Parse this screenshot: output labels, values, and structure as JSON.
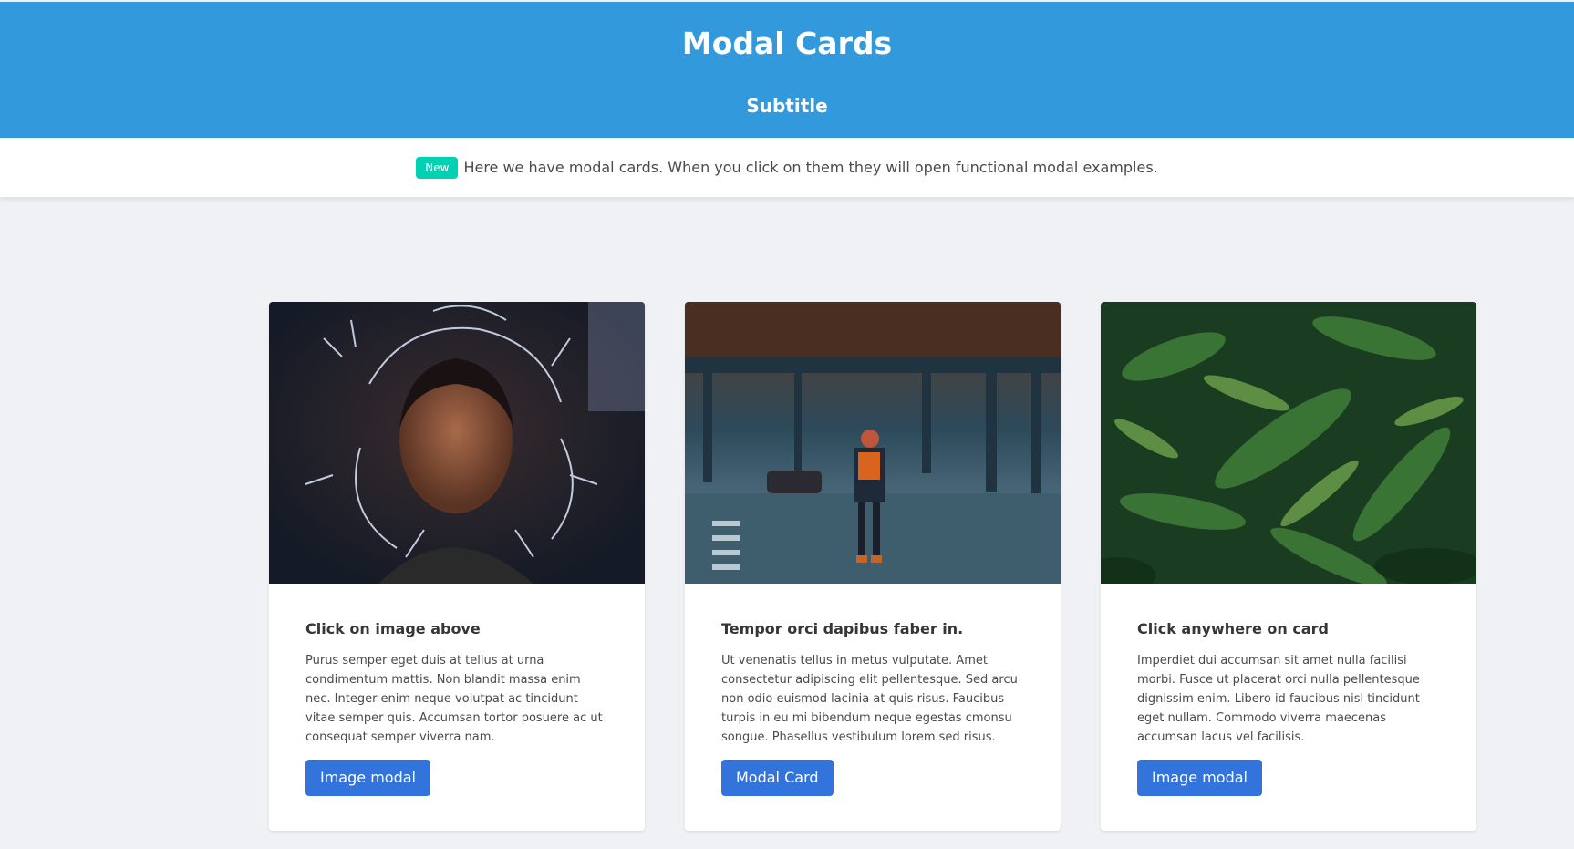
{
  "hero": {
    "title": "Modal Cards",
    "subtitle": "Subtitle",
    "background": "#3399dd"
  },
  "notice": {
    "tag": "New",
    "text": "Here we have modal cards. When you click on them they will open functional modal examples."
  },
  "cards": [
    {
      "title": "Click on image above",
      "text": "Purus semper eget duis at tellus at urna condimentum mattis. Non blandit massa enim nec. Integer enim neque volutpat ac tincidunt vitae semper quis. Accumsan tortor posuere ac ut consequat semper viverra nam.",
      "button": "Image modal",
      "image": "sparkler-portrait-photo"
    },
    {
      "title": "Tempor orci dapibus faber in.",
      "text": "Ut venenatis tellus in metus vulputate. Amet consectetur adipiscing elit pellentesque. Sed arcu non odio euismod lacinia at quis risus. Faucibus turpis in eu mi bibendum neque egestas cmonsu songue. Phasellus vestibulum lorem sed risus.",
      "button": "Modal Card",
      "image": "city-street-photo"
    },
    {
      "title": "Click anywhere on card",
      "text": "Imperdiet dui accumsan sit amet nulla facilisi morbi. Fusce ut placerat orci nulla pellentesque dignissim enim. Libero id faucibus nisl tincidunt eget nullam. Commodo viverra maecenas accumsan lacus vel facilisis.",
      "button": "Image modal",
      "image": "fern-leaves-photo"
    }
  ],
  "colors": {
    "accent": "#3273dc",
    "tag": "#00d1b2",
    "background": "#eff1f4"
  }
}
